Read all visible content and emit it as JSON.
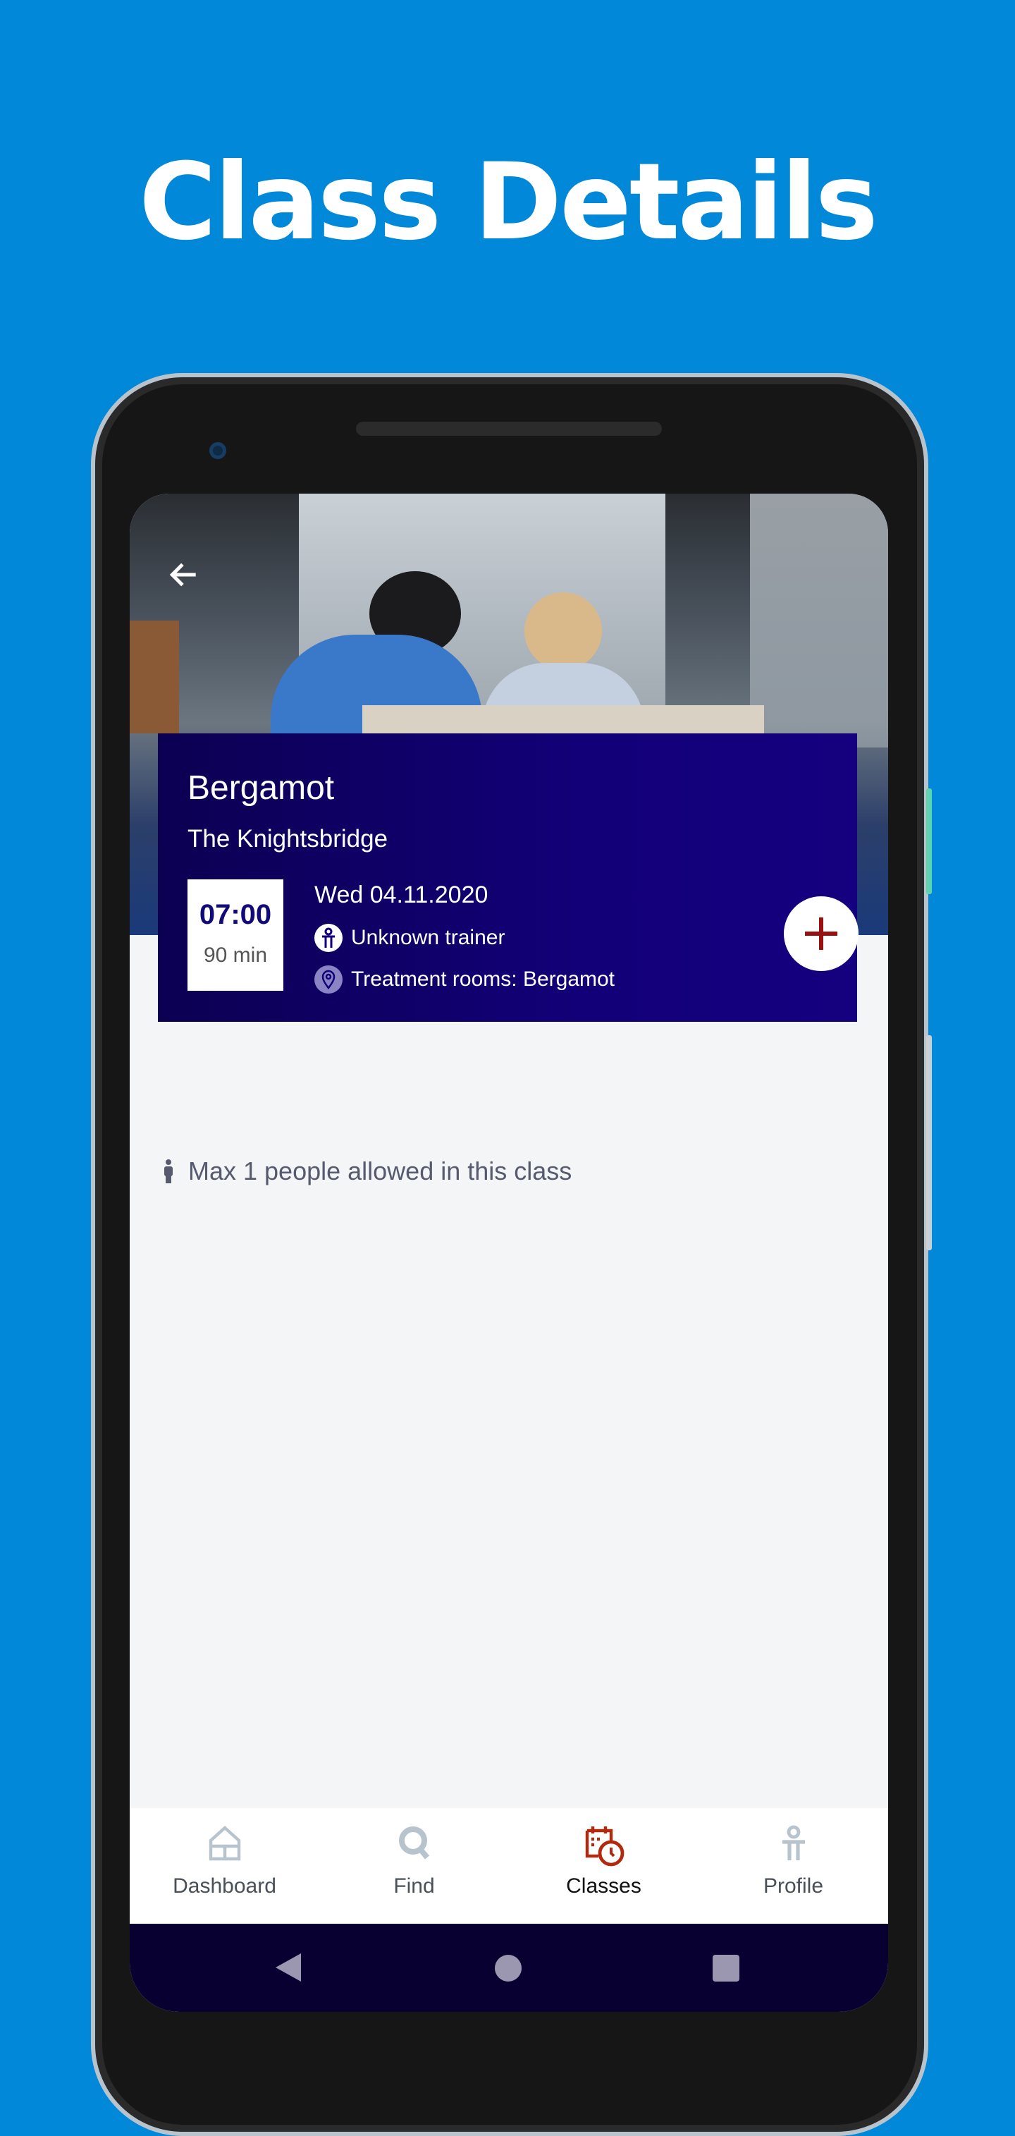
{
  "headline": "Class Details",
  "class": {
    "title": "Bergamot",
    "venue": "The Knightsbridge",
    "time": "07:00",
    "duration": "90 min",
    "date": "Wed 04.11.2020",
    "trainer": "Unknown trainer",
    "location": "Treatment rooms: Bergamot"
  },
  "capacity_text": "Max 1 people allowed in this class",
  "nav": [
    {
      "label": "Dashboard",
      "icon": "home-icon"
    },
    {
      "label": "Find",
      "icon": "search-icon"
    },
    {
      "label": "Classes",
      "icon": "calendar-clock-icon",
      "active": true
    },
    {
      "label": "Profile",
      "icon": "person-icon"
    }
  ],
  "colors": {
    "background": "#0288d8",
    "card": "#120078",
    "accent": "#b22a0e",
    "plus": "#9b0f0f",
    "nav_inactive": "#b7c3cd"
  }
}
